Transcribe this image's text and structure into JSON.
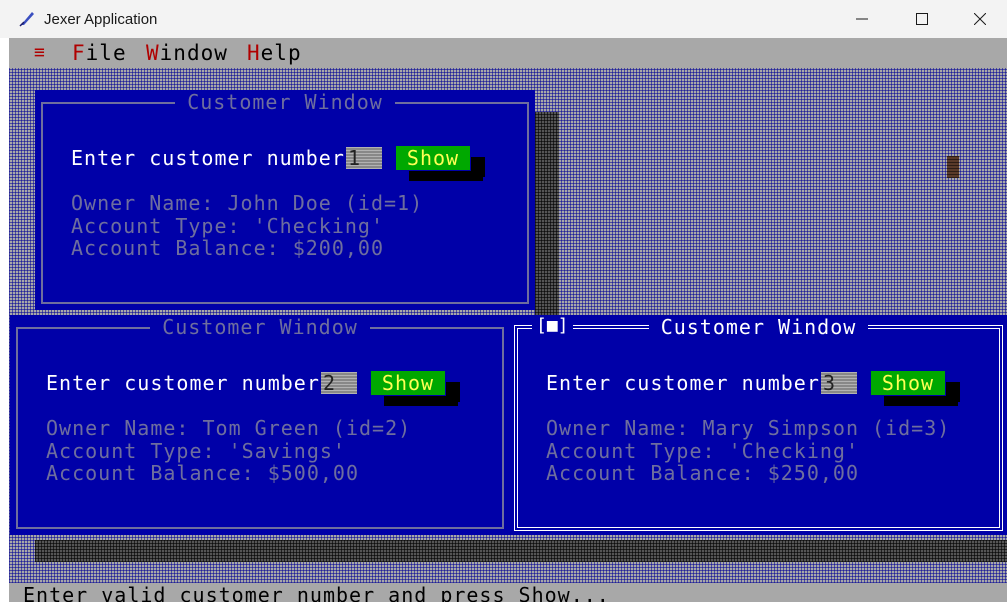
{
  "window": {
    "title": "Jexer Application",
    "icon": "feather-icon",
    "controls": {
      "minimize": "─",
      "maximize": "☐",
      "close": "✕"
    }
  },
  "menubar": {
    "system": "≡",
    "items": [
      {
        "hot": "F",
        "rest": "ile"
      },
      {
        "hot": "W",
        "rest": "indow"
      },
      {
        "hot": "H",
        "rest": "elp"
      }
    ]
  },
  "customer_windows": [
    {
      "title": "Customer Window",
      "prompt": "Enter customer number:",
      "number": "1",
      "button": "Show",
      "owner": "Owner Name: John Doe (id=1)",
      "type": "Account Type: 'Checking'",
      "balance": "Account Balance: $200,00",
      "active": false
    },
    {
      "title": "Customer Window",
      "prompt": "Enter customer number:",
      "number": "2",
      "button": "Show",
      "owner": "Owner Name: Tom Green (id=2)",
      "type": "Account Type: 'Savings'",
      "balance": "Account Balance: $500,00",
      "active": false
    },
    {
      "title": "Customer Window",
      "prompt": "Enter customer number:",
      "number": "3",
      "button": "Show",
      "owner": "Owner Name: Mary Simpson (id=3)",
      "type": "Account Type: 'Checking'",
      "balance": "Account Balance: $250,00",
      "active": true,
      "close_box": "[■]"
    }
  ],
  "statusbar": {
    "text": "Enter valid customer number and press Show..."
  },
  "colors": {
    "window_bg": "#0000a8",
    "button_bg": "#00a800",
    "button_text": "#ffff55",
    "hotkey": "#b00000"
  }
}
